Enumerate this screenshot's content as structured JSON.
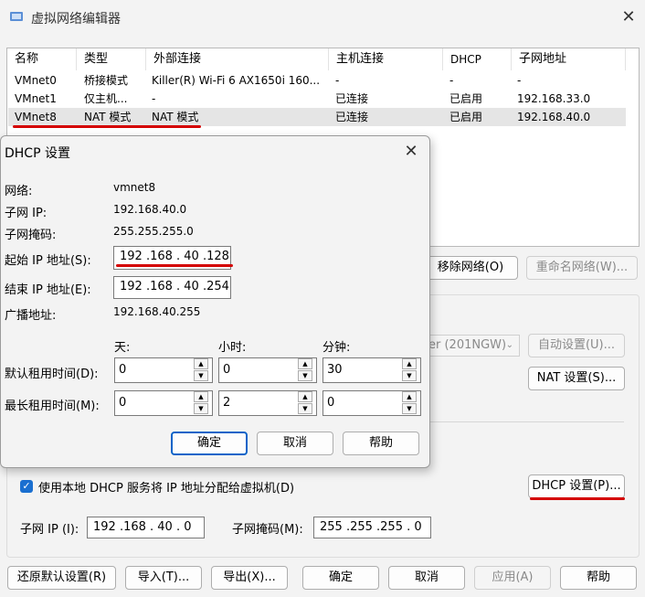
{
  "window": {
    "title": "虚拟网络编辑器"
  },
  "list": {
    "headers": [
      "名称",
      "类型",
      "外部连接",
      "主机连接",
      "DHCP",
      "子网地址"
    ],
    "rows": [
      [
        "VMnet0",
        "桥接模式",
        "Killer(R) Wi-Fi 6 AX1650i 160...",
        "-",
        "-",
        "-"
      ],
      [
        "VMnet1",
        "仅主机...",
        "-",
        "已连接",
        "已启用",
        "192.168.33.0"
      ],
      [
        "VMnet8",
        "NAT 模式",
        "NAT 模式",
        "已连接",
        "已启用",
        "192.168.40.0"
      ]
    ],
    "selected_row": 2
  },
  "buttons": {
    "remove_network": "移除网络(O)",
    "rename_network": "重命名网络(W)...",
    "auto_settings": "自动设置(U)...",
    "nat_settings": "NAT 设置(S)...",
    "dhcp_settings": "DHCP 设置(P)...",
    "restore_defaults": "还原默认设置(R)",
    "import": "导入(T)...",
    "export": "导出(X)...",
    "ok": "确定",
    "cancel": "取消",
    "apply": "应用(A)",
    "help": "帮助"
  },
  "bridge_select_partial": "er (201NGW)",
  "use_dhcp_label": "使用本地 DHCP 服务将 IP 地址分配给虚拟机(D)",
  "subnet_ip_label": "子网 IP (I):",
  "subnet_ip_value": "192 .168 . 40 .  0",
  "subnet_mask_label": "子网掩码(M):",
  "subnet_mask_value": "255 .255 .255 .  0",
  "dialog": {
    "title": "DHCP 设置",
    "network_label": "网络:",
    "network_value": "vmnet8",
    "subnet_ip_label": "子网 IP:",
    "subnet_ip_value": "192.168.40.0",
    "subnet_mask_label": "子网掩码:",
    "subnet_mask_value": "255.255.255.0",
    "start_ip_label": "起始 IP 地址(S):",
    "start_ip_value": "192 .168 . 40 .128",
    "end_ip_label": "结束 IP 地址(E):",
    "end_ip_value": "192 .168 . 40 .254",
    "broadcast_label": "广播地址:",
    "broadcast_value": "192.168.40.255",
    "col_days": "天:",
    "col_hours": "小时:",
    "col_minutes": "分钟:",
    "default_lease_label": "默认租用时间(D):",
    "default_lease": [
      "0",
      "0",
      "30"
    ],
    "max_lease_label": "最长租用时间(M):",
    "max_lease": [
      "0",
      "2",
      "0"
    ],
    "ok": "确定",
    "cancel": "取消",
    "help": "帮助"
  },
  "accent_color": "#0a64c8",
  "annotation_color": "#d40000"
}
